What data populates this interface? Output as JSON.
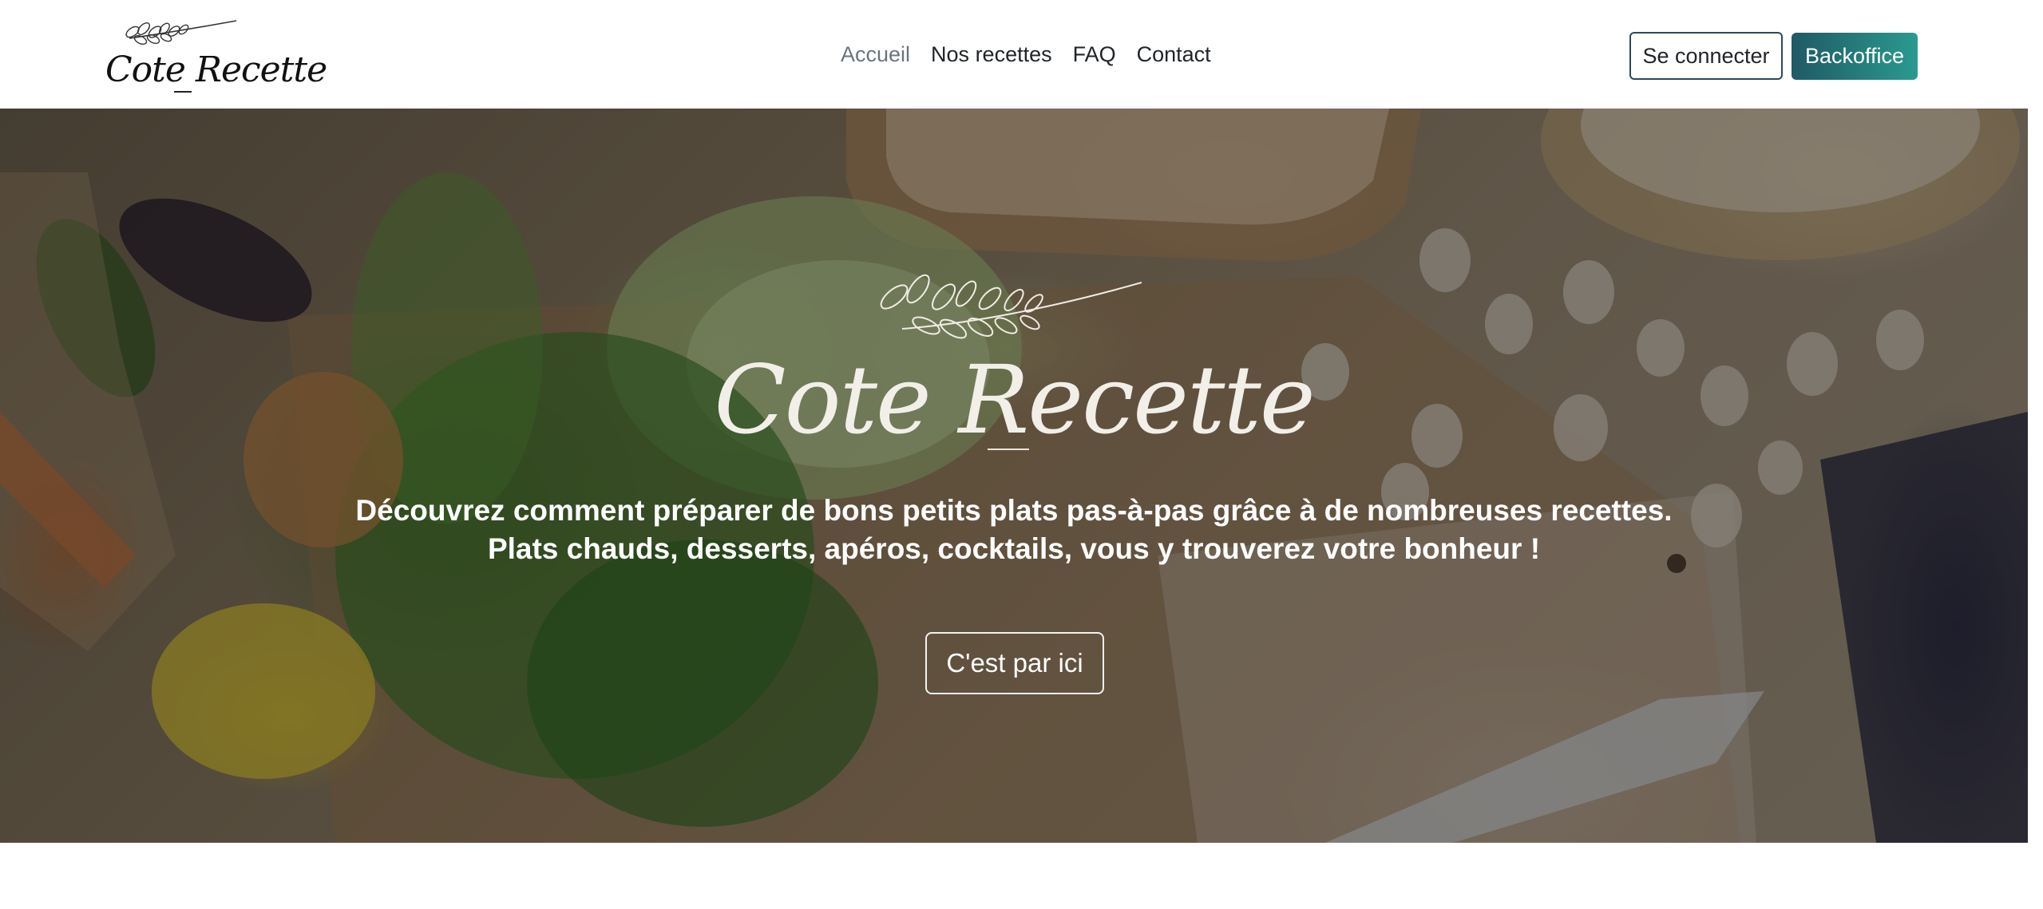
{
  "header": {
    "logo_text": "Cote Recette",
    "nav": [
      {
        "label": "Accueil",
        "active": true
      },
      {
        "label": "Nos recettes",
        "active": false
      },
      {
        "label": "FAQ",
        "active": false
      },
      {
        "label": "Contact",
        "active": false
      }
    ],
    "login_label": "Se connecter",
    "backoffice_label": "Backoffice"
  },
  "hero": {
    "title": "Cote Recette",
    "line1": "Découvrez comment préparer de bons petits plats pas-à-pas grâce à de nombreuses recettes.",
    "line2": "Plats chauds, desserts, apéros, cocktails, vous y trouverez votre bonheur !",
    "cta_label": "C'est par ici"
  },
  "colors": {
    "nav_active": "#6c757d",
    "backoffice_start": "#1f5a64",
    "backoffice_end": "#2a9a8f"
  },
  "icons": [
    "logo-branch-icon",
    "hero-branch-icon"
  ]
}
